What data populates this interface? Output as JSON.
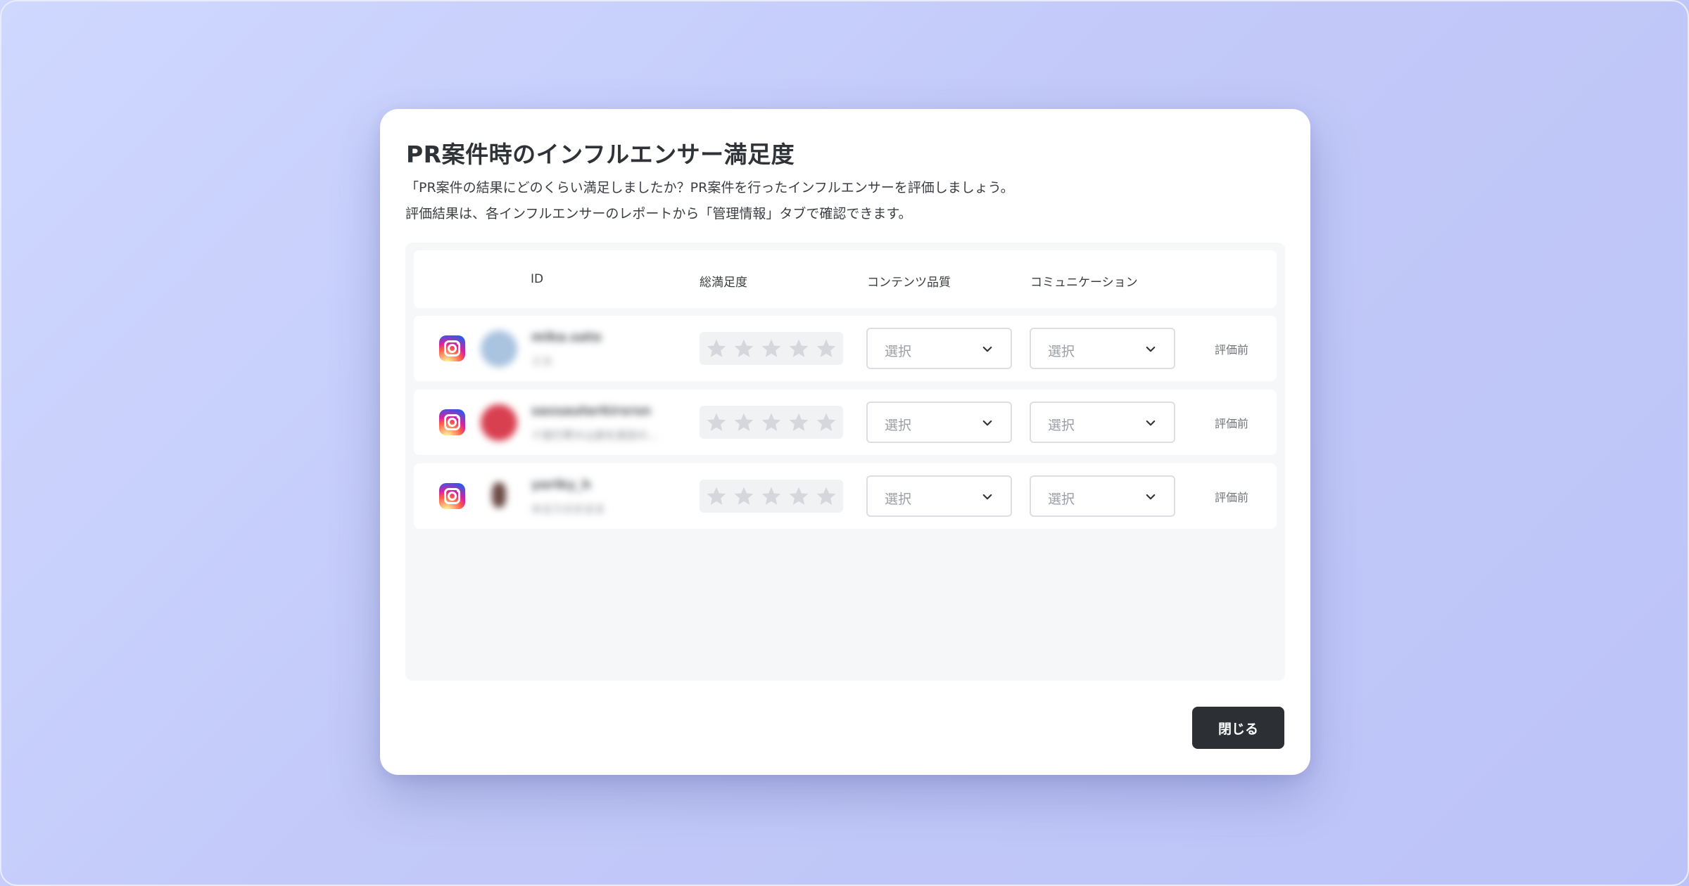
{
  "modal": {
    "title": "PR案件時のインフルエンサー満足度",
    "description_line1": "「PR案件の結果にどのくらい満足しましたか？PR案件を行ったインフルエンサーを評価しましょう。",
    "description_line2": "評価結果は、各インフルエンサーのレポートから「管理情報」タブで確認できます。",
    "close_label": "閉じる"
  },
  "table": {
    "headers": {
      "id": "ID",
      "total": "総満足度",
      "content_quality": "コンテンツ品質",
      "communication": "コミュニケーション"
    },
    "rows": [
      {
        "platform_icon": "instagram-icon",
        "name": "mika.sato",
        "subtitle": "ミカ",
        "rating": 0,
        "max_rating": 5,
        "content_quality": "選択",
        "communication": "選択",
        "status": "評価前"
      },
      {
        "platform_icon": "instagram-icon",
        "name": "saxsauterkirsrsn",
        "subtitle": "ナ旅行帯ホ山旅を旅目の...",
        "rating": 0,
        "max_rating": 5,
        "content_quality": "選択",
        "communication": "選択",
        "status": "評価前"
      },
      {
        "platform_icon": "instagram-icon",
        "name": "yoriky_h",
        "subtitle": "ゆるりのきまま",
        "rating": 0,
        "max_rating": 5,
        "content_quality": "選択",
        "communication": "選択",
        "status": "評価前"
      }
    ]
  },
  "colors": {
    "background": "#c3caf9",
    "button": "#2c3034",
    "star_empty": "#d5d7dc"
  }
}
